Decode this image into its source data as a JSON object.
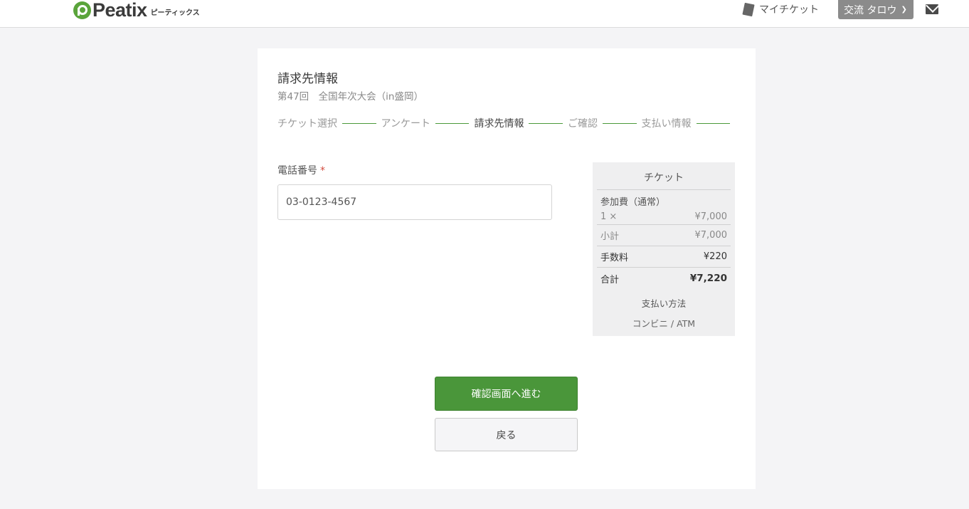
{
  "header": {
    "logo_text": "Peatix",
    "logo_sub": "ピーティックス",
    "my_tickets": "マイチケット",
    "user_name": "交流 タロウ"
  },
  "page": {
    "title": "請求先情報",
    "event_name": "第47回　全国年次大会（in盛岡）"
  },
  "steps": [
    {
      "label": "チケット選択",
      "active": false
    },
    {
      "label": "アンケート",
      "active": false
    },
    {
      "label": "請求先情報",
      "active": true
    },
    {
      "label": "ご確認",
      "active": false
    },
    {
      "label": "支払い情報",
      "active": false
    }
  ],
  "form": {
    "phone_label": "電話番号",
    "required_mark": "*",
    "phone_value": "03-0123-4567"
  },
  "summary": {
    "heading": "チケット",
    "item_name": "参加費（通常）",
    "qty": "1 ×",
    "item_price": "¥7,000",
    "subtotal_label": "小計",
    "subtotal": "¥7,000",
    "fee_label": "手数料",
    "fee": "¥220",
    "total_label": "合計",
    "total": "¥7,220",
    "pay_label": "支払い方法",
    "pay_method": "コンビニ / ATM"
  },
  "buttons": {
    "next": "確認画面へ進む",
    "back": "戻る"
  },
  "colors": {
    "accent_green": "#4a963a",
    "required_red": "#d24b3e"
  }
}
